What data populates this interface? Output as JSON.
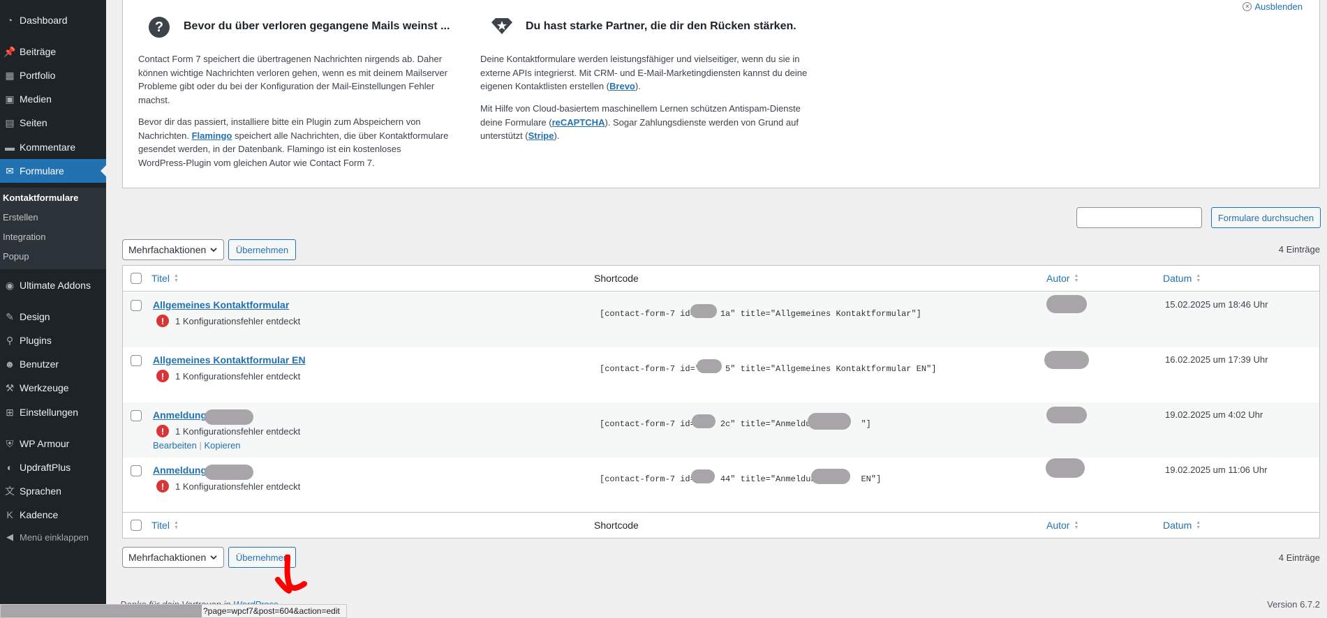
{
  "sidebar": {
    "items": [
      {
        "label": "Dashboard",
        "icon": "dashboard-icon",
        "glyph": "◔"
      },
      {
        "label": "Beiträge",
        "icon": "pushpin-icon",
        "glyph": "📌"
      },
      {
        "label": "Portfolio",
        "icon": "portfolio-icon",
        "glyph": "▦"
      },
      {
        "label": "Medien",
        "icon": "media-icon",
        "glyph": "▣"
      },
      {
        "label": "Seiten",
        "icon": "pages-icon",
        "glyph": "▤"
      },
      {
        "label": "Kommentare",
        "icon": "comment-icon",
        "glyph": "▬"
      },
      {
        "label": "Formulare",
        "icon": "mail-icon",
        "glyph": "✉"
      },
      {
        "label": "Ultimate Addons",
        "icon": "addons-icon",
        "glyph": "◉"
      },
      {
        "label": "Design",
        "icon": "brush-icon",
        "glyph": "✎"
      },
      {
        "label": "Plugins",
        "icon": "plugin-icon",
        "glyph": "⚲"
      },
      {
        "label": "Benutzer",
        "icon": "user-icon",
        "glyph": "☻"
      },
      {
        "label": "Werkzeuge",
        "icon": "wrench-icon",
        "glyph": "⚒"
      },
      {
        "label": "Einstellungen",
        "icon": "settings-icon",
        "glyph": "⊞"
      },
      {
        "label": "WP Armour",
        "icon": "shield-icon",
        "glyph": "⛨"
      },
      {
        "label": "UpdraftPlus",
        "icon": "updraft-icon",
        "glyph": "◐"
      },
      {
        "label": "Sprachen",
        "icon": "translate-icon",
        "glyph": "文"
      },
      {
        "label": "Kadence",
        "icon": "kadence-icon",
        "glyph": "K"
      }
    ],
    "collapse_label": "Menü einklappen",
    "submenu": [
      "Kontaktformulare",
      "Erstellen",
      "Integration",
      "Popup"
    ]
  },
  "welcome": {
    "dismiss": "Ausblenden",
    "col1": {
      "title": "Bevor du über verloren gegangene Mails weinst ...",
      "p1": "Contact Form 7 speichert die übertragenen Nachrichten nirgends ab. Daher können wichtige Nachrichten verloren gehen, wenn es mit deinem Mailserver Probleme gibt oder du bei der Konfiguration der Mail-Einstellungen Fehler machst.",
      "p2_a": "Bevor dir das passiert, installiere bitte ein Plugin zum Abspeichern von Nachrichten. ",
      "p2_link": "Flamingo",
      "p2_b": " speichert alle Nachrichten, die über Kontaktformulare gesendet werden, in der Datenbank. Flamingo ist ein kostenloses WordPress-Plugin vom gleichen Autor wie Contact Form 7."
    },
    "col2": {
      "title": "Du hast starke Partner, die dir den Rücken stärken.",
      "p1_a": "Deine Kontaktformulare werden leistungsfähiger und vielseitiger, wenn du sie in externe APIs integrierst. Mit CRM- und E-Mail-Marketingdiensten kannst du deine eigenen Kontaktlisten erstellen (",
      "p1_link": "Brevo",
      "p1_b": ").",
      "p2_a": "Mit Hilfe von Cloud-basiertem maschinellem Lernen schützen Antispam-Dienste deine Formulare (",
      "p2_link1": "reCAPTCHA",
      "p2_b": "). Sogar Zahlungsdienste werden von Grund auf unterstützt (",
      "p2_link2": "Stripe",
      "p2_c": ")."
    }
  },
  "search": {
    "button": "Formulare durchsuchen",
    "value": ""
  },
  "bulk": {
    "select": "Mehrfachaktionen",
    "apply": "Übernehmen"
  },
  "count": "4 Einträge",
  "table": {
    "columns": {
      "title": "Titel",
      "shortcode": "Shortcode",
      "author": "Autor",
      "date": "Datum"
    },
    "rows": [
      {
        "title": "Allgemeines Kontaktformular",
        "error": "1 Konfigurationsfehler entdeckt",
        "shortcode": "[contact-form-7 id=\"    1a\" title=\"Allgemeines Kontaktformular\"]",
        "date": "15.02.2025 um 18:46 Uhr"
      },
      {
        "title": "Allgemeines Kontaktformular EN",
        "error": "1 Konfigurationsfehler entdeckt",
        "shortcode": "[contact-form-7 id=\"5    5\" title=\"Allgemeines Kontaktformular EN\"]",
        "date": "16.02.2025 um 17:39 Uhr"
      },
      {
        "title": "Anmeldung",
        "error": "1 Konfigurationsfehler entdeckt",
        "shortcode": "[contact-form-7 id=\"e   2c\" title=\"Anmeldung        \"]",
        "date": "19.02.2025 um 4:02 Uhr",
        "actions": {
          "edit": "Bearbeiten",
          "sep": " | ",
          "copy": "Kopieren"
        }
      },
      {
        "title": "Anmeldung          EN",
        "error": "1 Konfigurationsfehler entdeckt",
        "shortcode": "[contact-form-7 id=\"b   44\" title=\"Anmeldung        EN\"]",
        "date": "19.02.2025 um 11:06 Uhr"
      }
    ]
  },
  "footer": {
    "thanks": "Danke für dein Vertrauen in ",
    "wp_link": "WordPress",
    "version": "Version 6.7.2",
    "status_url": "?page=wpcf7&post=604&action=edit"
  }
}
